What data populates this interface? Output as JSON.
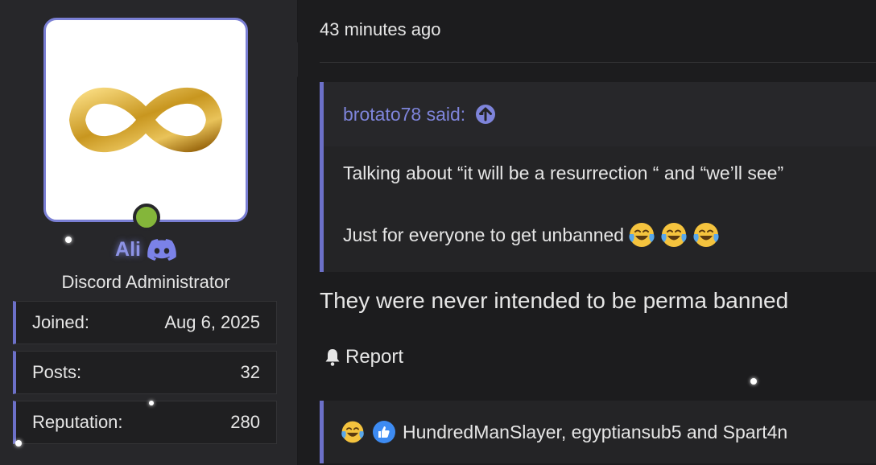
{
  "timestamp": "43 minutes ago",
  "user": {
    "name": "Ali",
    "title": "Discord Administrator",
    "stats": [
      {
        "label": "Joined:",
        "value": "Aug 6, 2025"
      },
      {
        "label": "Posts:",
        "value": "32"
      },
      {
        "label": "Reputation:",
        "value": "280"
      }
    ]
  },
  "quote": {
    "author": "brotato78 said:",
    "lines": [
      "Talking about “it will be a resurrection “ and “we’ll see”",
      "Just for everyone to get unbanned"
    ]
  },
  "message": "They were never intended to be perma banned",
  "report_label": "Report",
  "reactions_text": "HundredManSlayer, egyptiansub5 and Spart4n",
  "colors": {
    "accent": "#6c70c8",
    "username": "#8d93e6",
    "online": "#84b63a",
    "background": "#1c1c1e",
    "sidebar": "#27272a"
  },
  "icons": [
    "infinity-logo",
    "discord-icon",
    "arrow-up-circle-icon",
    "laughing-crying-emoji",
    "like-icon",
    "bell-icon"
  ]
}
